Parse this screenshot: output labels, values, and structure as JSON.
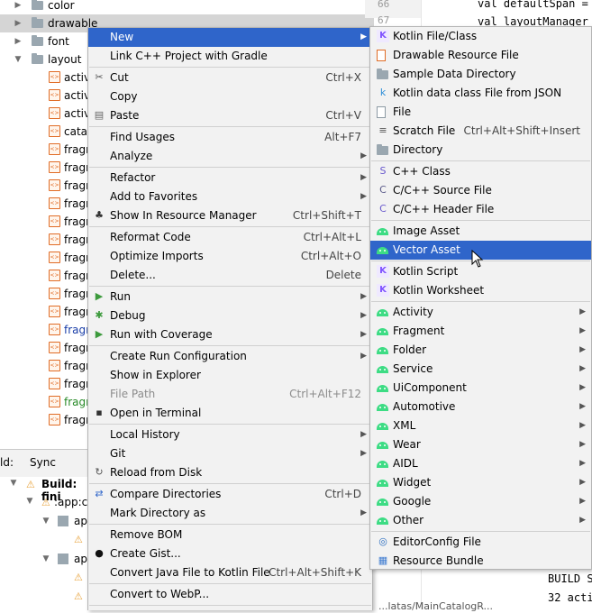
{
  "tree": {
    "folders": [
      {
        "label": "color"
      },
      {
        "label": "drawable"
      },
      {
        "label": "font"
      },
      {
        "label": "layout"
      }
    ],
    "files": [
      "activ",
      "activ",
      "activ",
      "catal",
      "fragr",
      "fragr",
      "fragr",
      "fragr",
      "fragr",
      "fragr",
      "fragr",
      "fragr",
      "fragr",
      "fragr",
      "fragr",
      "fragr",
      "fragr",
      "fragr",
      "fragr",
      "fragr"
    ]
  },
  "editor": {
    "line_numbers": [
      "66",
      "67"
    ],
    "lines": [
      "val defaultSpan =",
      "val layoutManager"
    ],
    "build_lines": [
      "BUILD S",
      "32 acti"
    ],
    "bottom_path": "...latas/MainCatalogR..."
  },
  "build_panel": {
    "tab_prefix": "ld:",
    "tab_sync": "Sync",
    "root": "Build: fini",
    "task": ":app:c",
    "child1": "app",
    "child2": "app"
  },
  "context_menu": [
    {
      "label": "New",
      "sub": true,
      "highlight": true
    },
    {
      "label": "Link C++ Project with Gradle"
    },
    {
      "label": "Cut",
      "key": "Ctrl+X",
      "icon": "scissors-icon"
    },
    {
      "label": "Copy"
    },
    {
      "label": "Paste",
      "key": "Ctrl+V",
      "icon": "clipboard-icon"
    },
    {
      "label": "Find Usages",
      "key": "Alt+F7"
    },
    {
      "label": "Analyze",
      "sub": true
    },
    {
      "label": "Refactor",
      "sub": true
    },
    {
      "label": "Add to Favorites",
      "sub": true
    },
    {
      "label": "Show In Resource Manager",
      "key": "Ctrl+Shift+T",
      "icon": "resource-manager-icon"
    },
    {
      "label": "Reformat Code",
      "key": "Ctrl+Alt+L"
    },
    {
      "label": "Optimize Imports",
      "key": "Ctrl+Alt+O"
    },
    {
      "label": "Delete...",
      "key": "Delete"
    },
    {
      "label": "Run",
      "sub": true,
      "icon": "run-icon"
    },
    {
      "label": "Debug",
      "sub": true,
      "icon": "debug-icon"
    },
    {
      "label": "Run with Coverage",
      "sub": true,
      "icon": "coverage-icon"
    },
    {
      "label": "Create Run Configuration",
      "sub": true
    },
    {
      "label": "Show in Explorer"
    },
    {
      "label": "File Path",
      "key": "Ctrl+Alt+F12",
      "disabled": true
    },
    {
      "label": "Open in Terminal",
      "icon": "terminal-icon"
    },
    {
      "label": "Local History",
      "sub": true
    },
    {
      "label": "Git",
      "sub": true
    },
    {
      "label": "Reload from Disk",
      "icon": "reload-icon"
    },
    {
      "label": "Compare Directories",
      "key": "Ctrl+D",
      "icon": "compare-icon"
    },
    {
      "label": "Mark Directory as",
      "sub": true
    },
    {
      "label": "Remove BOM"
    },
    {
      "label": "Create Gist...",
      "icon": "github-icon"
    },
    {
      "label": "Convert Java File to Kotlin File",
      "key": "Ctrl+Alt+Shift+K"
    },
    {
      "label": "Convert to WebP..."
    }
  ],
  "new_submenu": [
    {
      "label": "Kotlin File/Class",
      "icon": "kotlin-file-icon"
    },
    {
      "label": "Drawable Resource File",
      "icon": "xml-file-icon"
    },
    {
      "label": "Sample Data Directory",
      "icon": "folder-icon"
    },
    {
      "label": "Kotlin data class File from JSON",
      "icon": "json-kotlin-icon"
    },
    {
      "label": "File",
      "icon": "file-icon"
    },
    {
      "label": "Scratch File",
      "key": "Ctrl+Alt+Shift+Insert",
      "icon": "scratch-file-icon"
    },
    {
      "label": "Directory",
      "icon": "folder-icon"
    },
    {
      "label": "C++ Class",
      "icon": "cpp-class-icon"
    },
    {
      "label": "C/C++ Source File",
      "icon": "cpp-source-icon"
    },
    {
      "label": "C/C++ Header File",
      "icon": "cpp-header-icon"
    },
    {
      "label": "Image Asset",
      "icon": "android-icon"
    },
    {
      "label": "Vector Asset",
      "icon": "android-icon",
      "highlight": true
    },
    {
      "label": "Kotlin Script",
      "icon": "kotlin-script-icon"
    },
    {
      "label": "Kotlin Worksheet",
      "icon": "kotlin-worksheet-icon"
    },
    {
      "label": "Activity",
      "sub": true,
      "icon": "android-icon"
    },
    {
      "label": "Fragment",
      "sub": true,
      "icon": "android-icon"
    },
    {
      "label": "Folder",
      "sub": true,
      "icon": "android-icon"
    },
    {
      "label": "Service",
      "sub": true,
      "icon": "android-icon"
    },
    {
      "label": "UiComponent",
      "sub": true,
      "icon": "android-icon"
    },
    {
      "label": "Automotive",
      "sub": true,
      "icon": "android-icon"
    },
    {
      "label": "XML",
      "sub": true,
      "icon": "android-icon"
    },
    {
      "label": "Wear",
      "sub": true,
      "icon": "android-icon"
    },
    {
      "label": "AIDL",
      "sub": true,
      "icon": "android-icon"
    },
    {
      "label": "Widget",
      "sub": true,
      "icon": "android-icon"
    },
    {
      "label": "Google",
      "sub": true,
      "icon": "android-icon"
    },
    {
      "label": "Other",
      "sub": true,
      "icon": "android-icon"
    },
    {
      "label": "EditorConfig File",
      "icon": "editorconfig-icon"
    },
    {
      "label": "Resource Bundle",
      "icon": "resource-bundle-icon"
    }
  ],
  "colors": {
    "highlight": "#2f65ca",
    "menu_bg": "#f2f2f2",
    "android_green": "#3ddc84",
    "tree_selected": "#d5d5d5"
  }
}
